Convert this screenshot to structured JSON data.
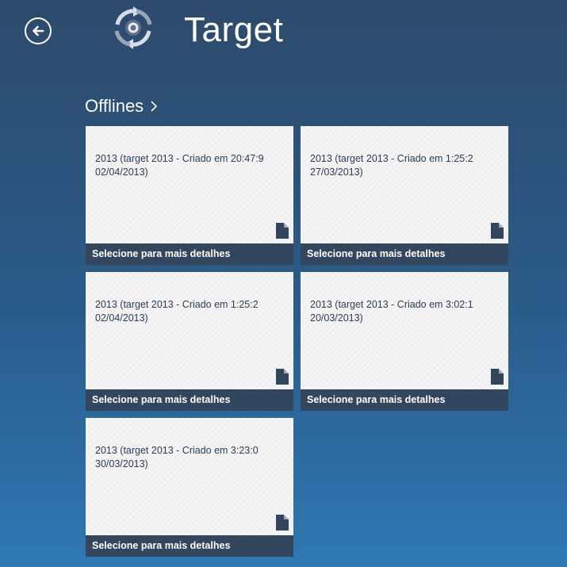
{
  "header": {
    "title": "Target",
    "back_icon": "back-arrow-icon",
    "logo_icon": "target-sync-logo-icon"
  },
  "section": {
    "title": "Offlines",
    "chevron_icon": "chevron-right-icon"
  },
  "tiles": [
    {
      "text_line1": "2013 (target 2013 - Criado em 20:47:9",
      "text_line2": "02/04/2013)",
      "footer": "Selecione para mais detalhes",
      "icon": "document-icon"
    },
    {
      "text_line1": "2013 (target 2013 - Criado em 1:25:2",
      "text_line2": "27/03/2013)",
      "footer": "Selecione para mais detalhes",
      "icon": "document-icon"
    },
    {
      "text_line1": "2013 (target 2013 - Criado em 1:25:2",
      "text_line2": "02/04/2013)",
      "footer": "Selecione para mais detalhes",
      "icon": "document-icon"
    },
    {
      "text_line1": "2013 (target 2013 - Criado em 3:02:1",
      "text_line2": "20/03/2013)",
      "footer": "Selecione para mais detalhes",
      "icon": "document-icon"
    },
    {
      "text_line1": "2013 (target 2013 - Criado em 3:23:0",
      "text_line2": "30/03/2013)",
      "footer": "Selecione para mais detalhes",
      "icon": "document-icon"
    }
  ],
  "colors": {
    "background_top": "#2d4a6b",
    "background_bottom": "#2e78b3",
    "tile_background": "#f4f4f4",
    "tile_footer": "#32465e",
    "tile_text": "#2b3e55"
  }
}
